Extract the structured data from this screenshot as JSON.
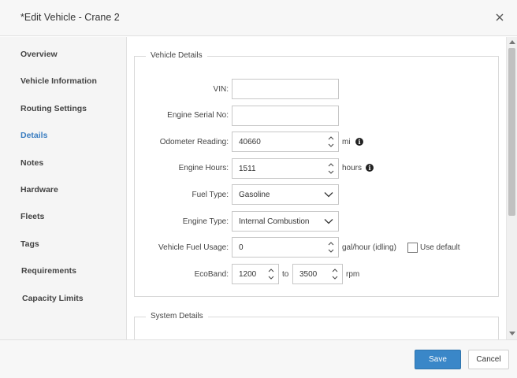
{
  "dialog": {
    "title": "*Edit Vehicle - Crane 2"
  },
  "sidebar": {
    "items": [
      {
        "label": "Overview"
      },
      {
        "label": "Vehicle Information"
      },
      {
        "label": "Routing Settings"
      },
      {
        "label": "Details"
      },
      {
        "label": "Notes"
      },
      {
        "label": "Hardware"
      },
      {
        "label": "Fleets"
      },
      {
        "label": "Tags"
      },
      {
        "label": "Requirements"
      },
      {
        "label": "Capacity Limits"
      }
    ],
    "active": "Details"
  },
  "vehicle_details": {
    "legend": "Vehicle Details",
    "vin": {
      "label": "VIN:",
      "value": ""
    },
    "engine_serial": {
      "label": "Engine Serial No:",
      "value": ""
    },
    "odometer": {
      "label": "Odometer Reading:",
      "value": "40660",
      "unit": "mi"
    },
    "engine_hours": {
      "label": "Engine Hours:",
      "value": "1511",
      "unit": "hours"
    },
    "fuel_type": {
      "label": "Fuel Type:",
      "value": "Gasoline"
    },
    "engine_type": {
      "label": "Engine Type:",
      "value": "Internal Combustion"
    },
    "fuel_usage": {
      "label": "Vehicle Fuel Usage:",
      "value": "0",
      "unit": "gal/hour (idling)",
      "use_default_label": "Use default",
      "use_default_checked": false
    },
    "ecoband": {
      "label": "EcoBand:",
      "min": "1200",
      "to": "to",
      "max": "3500",
      "unit": "rpm"
    }
  },
  "system_details": {
    "legend": "System Details"
  },
  "footer": {
    "save_label": "Save",
    "cancel_label": "Cancel"
  },
  "colors": {
    "accent": "#3a87c8",
    "active_nav": "#3a7dc0"
  },
  "icons": {
    "close": "close-icon",
    "info": "info-icon",
    "spinner": "spinner-arrows-icon",
    "dropdown": "chevron-down-icon"
  }
}
